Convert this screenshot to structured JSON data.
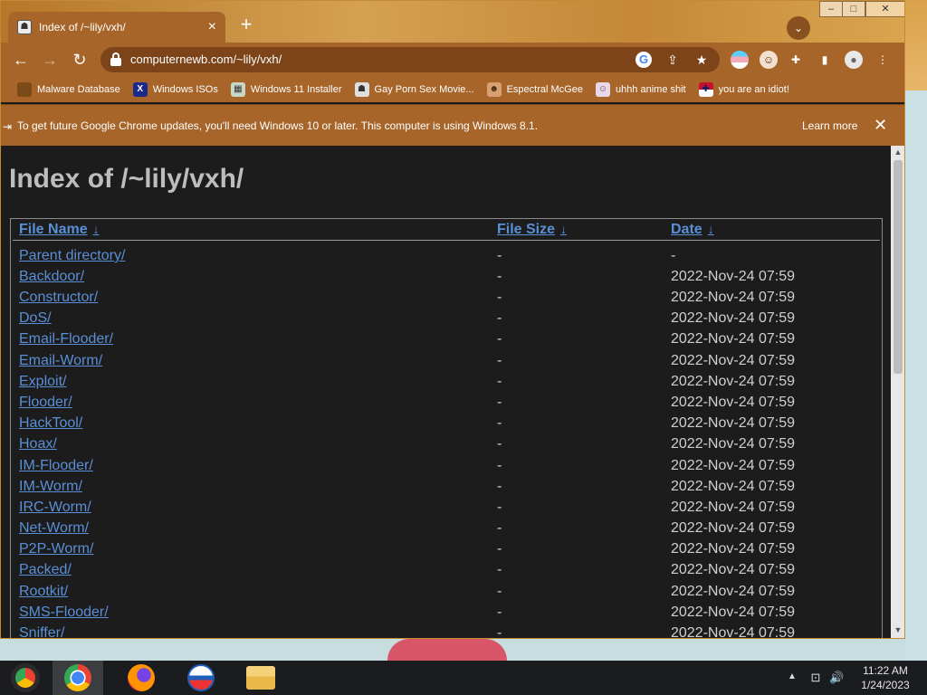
{
  "tab": {
    "title": "Index of /~lily/vxh/"
  },
  "omnibox": {
    "url": "computernewb.com/~lily/vxh/"
  },
  "bookmarks": [
    {
      "label": "Malware Database",
      "icon": "bookmark-icon"
    },
    {
      "label": "Windows ISOs",
      "icon": "x-logo-icon"
    },
    {
      "label": "Windows 11 Installer",
      "icon": "installer-icon"
    },
    {
      "label": "Gay Porn Sex Movie...",
      "icon": "site-icon"
    },
    {
      "label": "Espectral McGee",
      "icon": "avatar-icon"
    },
    {
      "label": "uhhh anime shit",
      "icon": "anime-icon"
    },
    {
      "label": "you are an idiot!",
      "icon": "flag-icon"
    }
  ],
  "infobar": {
    "message": "To get future Google Chrome updates, you'll need Windows 10 or later. This computer is using Windows 8.1.",
    "learn_more": "Learn more"
  },
  "page": {
    "title": "Index of /~lily/vxh/",
    "headers": {
      "name": "File Name",
      "size": "File Size",
      "date": "Date",
      "sort_arrow": "↓"
    },
    "rows": [
      {
        "name": "Parent directory/",
        "size": "-",
        "date": "-"
      },
      {
        "name": "Backdoor/",
        "size": "-",
        "date": "2022-Nov-24 07:59"
      },
      {
        "name": "Constructor/",
        "size": "-",
        "date": "2022-Nov-24 07:59"
      },
      {
        "name": "DoS/",
        "size": "-",
        "date": "2022-Nov-24 07:59"
      },
      {
        "name": "Email-Flooder/",
        "size": "-",
        "date": "2022-Nov-24 07:59"
      },
      {
        "name": "Email-Worm/",
        "size": "-",
        "date": "2022-Nov-24 07:59"
      },
      {
        "name": "Exploit/",
        "size": "-",
        "date": "2022-Nov-24 07:59"
      },
      {
        "name": "Flooder/",
        "size": "-",
        "date": "2022-Nov-24 07:59"
      },
      {
        "name": "HackTool/",
        "size": "-",
        "date": "2022-Nov-24 07:59"
      },
      {
        "name": "Hoax/",
        "size": "-",
        "date": "2022-Nov-24 07:59"
      },
      {
        "name": "IM-Flooder/",
        "size": "-",
        "date": "2022-Nov-24 07:59"
      },
      {
        "name": "IM-Worm/",
        "size": "-",
        "date": "2022-Nov-24 07:59"
      },
      {
        "name": "IRC-Worm/",
        "size": "-",
        "date": "2022-Nov-24 07:59"
      },
      {
        "name": "Net-Worm/",
        "size": "-",
        "date": "2022-Nov-24 07:59"
      },
      {
        "name": "P2P-Worm/",
        "size": "-",
        "date": "2022-Nov-24 07:59"
      },
      {
        "name": "Packed/",
        "size": "-",
        "date": "2022-Nov-24 07:59"
      },
      {
        "name": "Rootkit/",
        "size": "-",
        "date": "2022-Nov-24 07:59"
      },
      {
        "name": "SMS-Flooder/",
        "size": "-",
        "date": "2022-Nov-24 07:59"
      },
      {
        "name": "Sniffer/",
        "size": "-",
        "date": "2022-Nov-24 07:59"
      }
    ]
  },
  "taskbar": {
    "apps": [
      "start-button",
      "chrome-icon",
      "firefox-icon",
      "outlook-icon",
      "file-explorer-icon"
    ],
    "clock": {
      "time": "11:22 AM",
      "date": "1/24/2023"
    }
  },
  "colors": {
    "chrome_frame": "#a8652a",
    "link": "#5a8fd6",
    "page_bg": "#1c1c1c"
  }
}
